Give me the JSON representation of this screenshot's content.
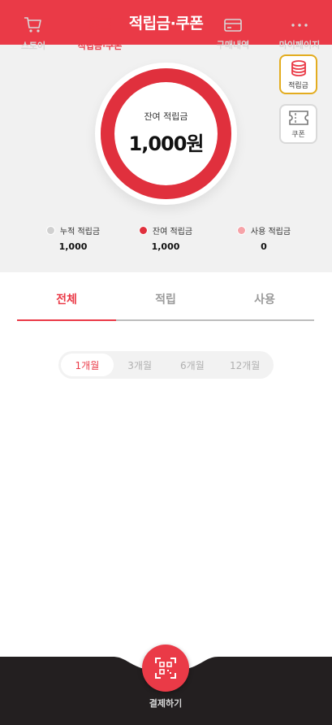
{
  "header": {
    "title": "적립금·쿠폰"
  },
  "summary": {
    "center_label": "잔여 적립금",
    "center_value": "1,000원",
    "side_buttons": [
      {
        "label": "적립금",
        "icon": "coins-icon",
        "active": true
      },
      {
        "label": "쿠폰",
        "icon": "ticket-icon",
        "active": false
      }
    ],
    "legend": [
      {
        "name": "누적 적립금",
        "value": "1,000",
        "color": "#d0d0d0"
      },
      {
        "name": "잔여 적립금",
        "value": "1,000",
        "color": "#e0303d"
      },
      {
        "name": "사용 적립금",
        "value": "0",
        "color": "#f6a3a8"
      }
    ],
    "donut_fraction_remaining": 1.0
  },
  "tabs": [
    {
      "label": "전체",
      "active": true
    },
    {
      "label": "적립",
      "active": false
    },
    {
      "label": "사용",
      "active": false
    }
  ],
  "periods": [
    {
      "label": "1개월",
      "active": true
    },
    {
      "label": "3개월",
      "active": false
    },
    {
      "label": "6개월",
      "active": false
    },
    {
      "label": "12개월",
      "active": false
    }
  ],
  "bottom_nav": {
    "items": [
      {
        "label": "스토어",
        "icon": "cart-icon",
        "active": false
      },
      {
        "label": "적립금·쿠폰",
        "icon": "coins-coupon-icon",
        "active": true
      },
      {
        "label": "결제하기",
        "icon": "qr-scan-icon",
        "active": false
      },
      {
        "label": "구매내역",
        "icon": "card-icon",
        "active": false
      },
      {
        "label": "마이페이지",
        "icon": "more-dots-icon",
        "active": false
      }
    ]
  },
  "colors": {
    "brand": "#ea3a47",
    "dark": "#231f20",
    "gold": "#e3ac1f",
    "panel": "#f1f1f1"
  }
}
